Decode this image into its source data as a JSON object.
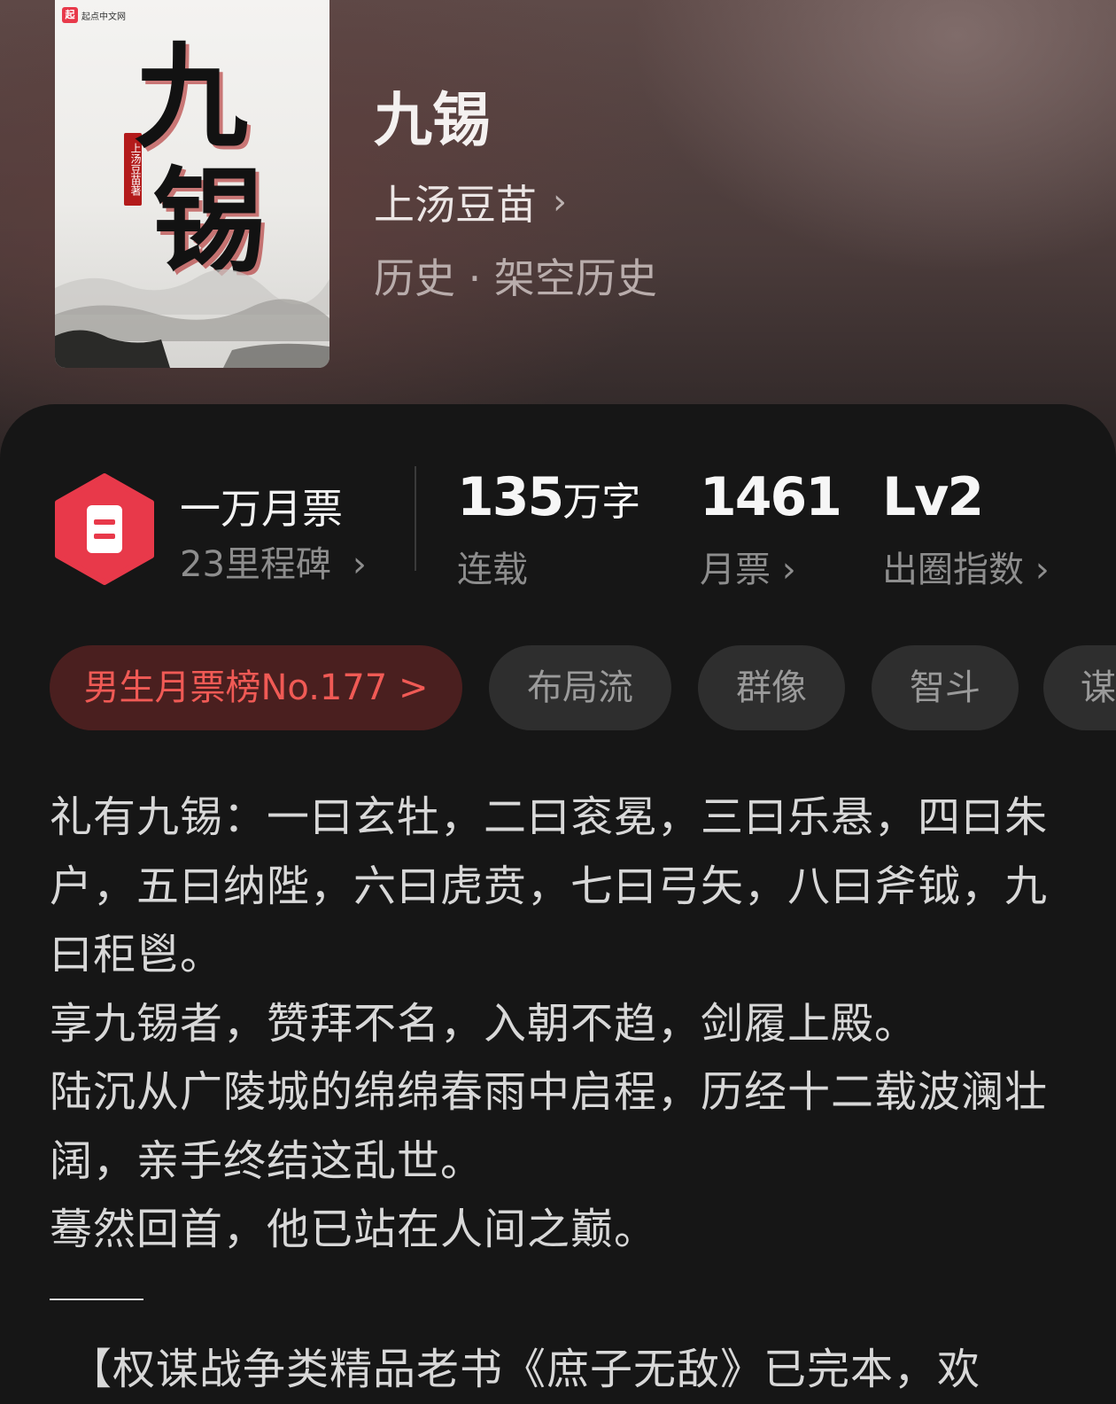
{
  "cover": {
    "publisher_label": "起点中文网",
    "art_title_chars": [
      "九",
      "锡"
    ],
    "seal_text": "上汤豆苗著"
  },
  "book": {
    "title": "九锡",
    "author": "上汤豆苗",
    "genre": "历史 · 架空历史"
  },
  "stats": {
    "milestone_title": "一万月票",
    "milestone_sub": "23里程碑",
    "word_count_number": "135",
    "word_count_unit": "万字",
    "word_count_label": "连载",
    "monthly_votes": "1461",
    "monthly_votes_label": "月票",
    "level": "Lv2",
    "level_label": "出圈指数"
  },
  "tags": {
    "rank": "男生月票榜No.177 >",
    "items": [
      "布局流",
      "群像",
      "智斗",
      "谋"
    ]
  },
  "description": {
    "paragraphs": [
      "礼有九锡：一曰玄牡，二曰衮冕，三曰乐悬，四曰朱户，五曰纳陛，六曰虎贲，七曰弓矢，八曰斧钺，九曰秬鬯。",
      "享九锡者，赞拜不名，入朝不趋，剑履上殿。",
      "陆沉从广陵城的绵绵春雨中启程，历经十二载波澜壮阔，亲手终结这乱世。",
      "蓦然回首，他已站在人间之巅。"
    ],
    "continuation": "【权谋战争类精品老书《庶子无敌》已完本，欢"
  },
  "colors": {
    "accent_red": "#e8394a",
    "rank_text": "#f05a55",
    "rank_bg": "#4a1f1f",
    "panel_bg": "#161616"
  },
  "icons": {
    "chevron": "chevron-right-icon",
    "milestone": "ticket-hexagon-icon"
  }
}
